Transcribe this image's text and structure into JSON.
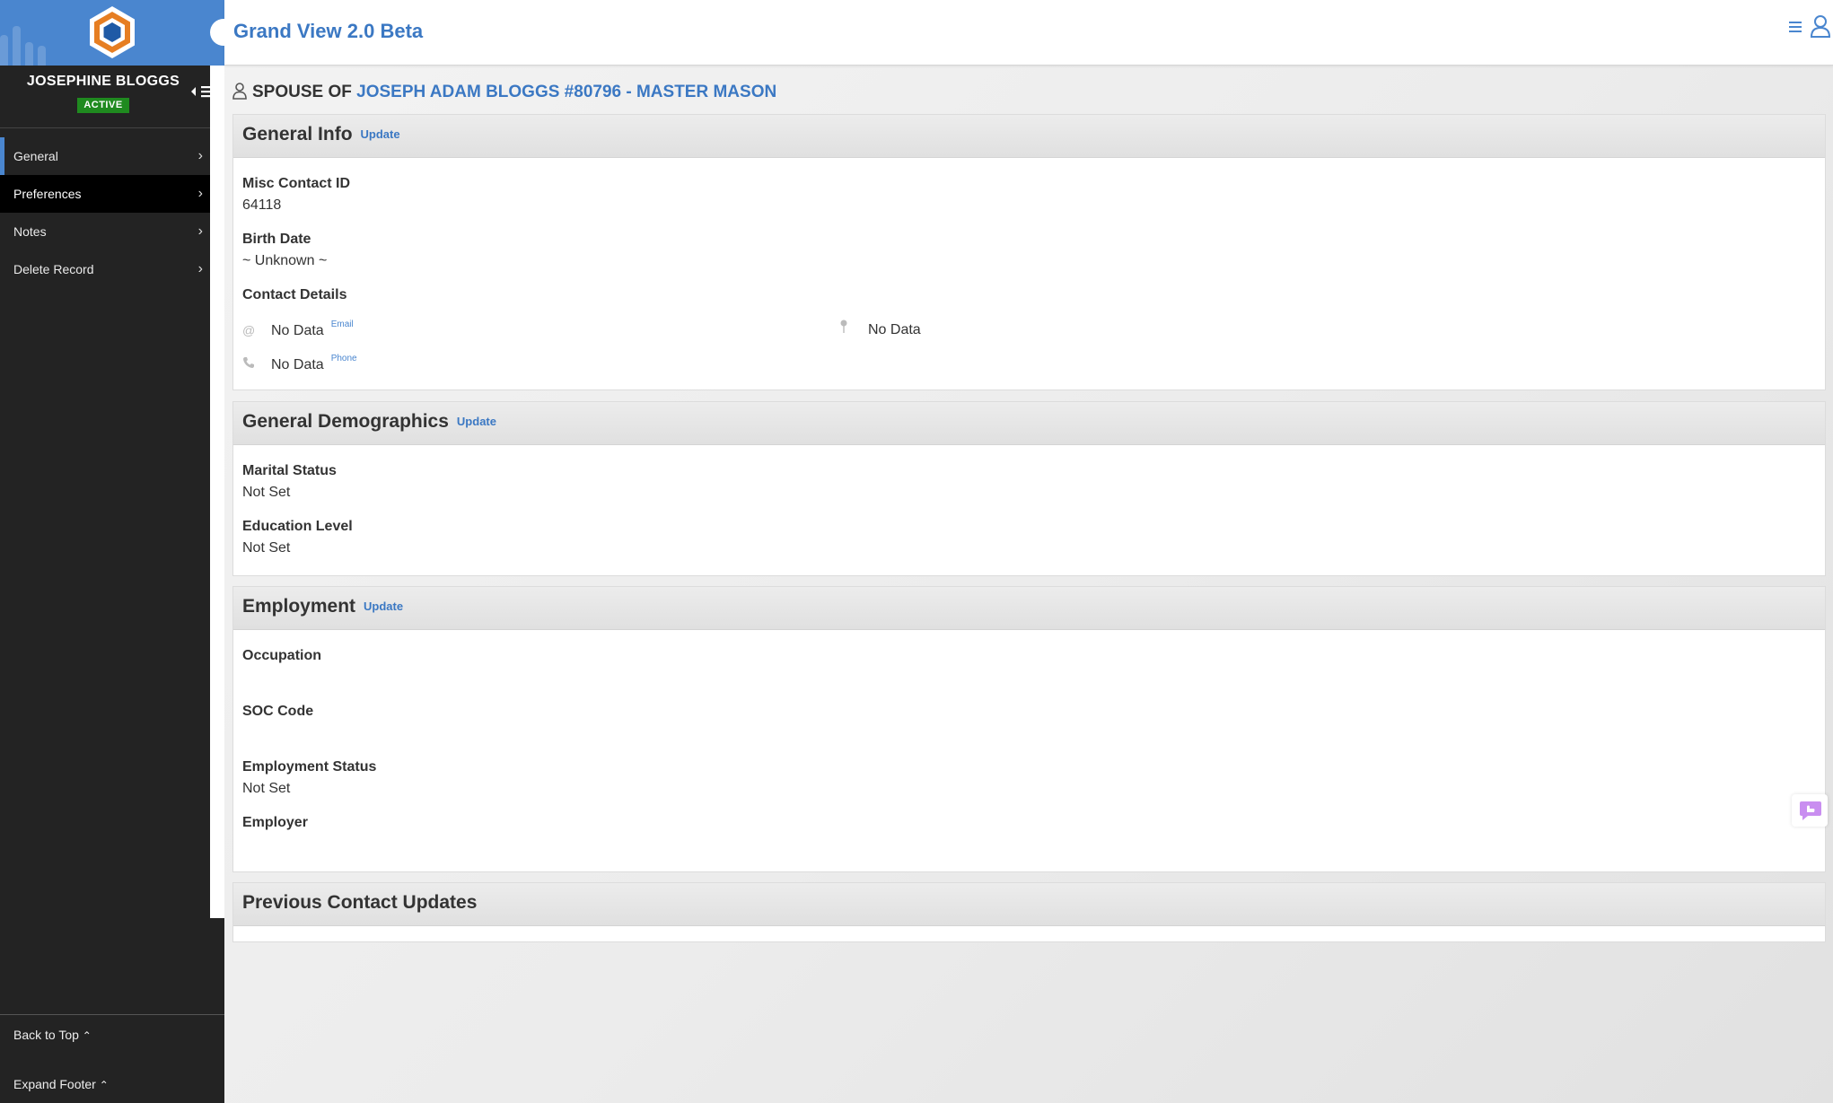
{
  "app": {
    "title": "Grand View 2.0 Beta"
  },
  "sidebar": {
    "user_name": "JOSEPHINE BLOGGS",
    "status": "ACTIVE",
    "items": [
      {
        "label": "General"
      },
      {
        "label": "Preferences"
      },
      {
        "label": "Notes"
      },
      {
        "label": "Delete Record"
      }
    ],
    "back_to_top": "Back to Top",
    "expand_footer": "Expand Footer"
  },
  "page": {
    "prefix": "SPOUSE OF",
    "link": "JOSEPH ADAM BLOGGS #80796 - MASTER MASON"
  },
  "general_info": {
    "title": "General Info",
    "update": "Update",
    "misc_contact_id_label": "Misc Contact ID",
    "misc_contact_id": "64118",
    "birth_date_label": "Birth Date",
    "birth_date": "~ Unknown ~",
    "contact_details_label": "Contact Details",
    "email_value": "No Data",
    "email_tag": "Email",
    "phone_value": "No Data",
    "phone_tag": "Phone",
    "address_value": "No Data"
  },
  "demographics": {
    "title": "General Demographics",
    "update": "Update",
    "marital_label": "Marital Status",
    "marital_value": "Not Set",
    "education_label": "Education Level",
    "education_value": "Not Set"
  },
  "employment": {
    "title": "Employment",
    "update": "Update",
    "occupation_label": "Occupation",
    "occupation_value": "",
    "soc_label": "SOC Code",
    "soc_value": "",
    "status_label": "Employment Status",
    "status_value": "Not Set",
    "employer_label": "Employer",
    "employer_value": ""
  },
  "previous_updates": {
    "title": "Previous Contact Updates"
  },
  "colors": {
    "accent": "#3b78c3",
    "sidebar_bg": "#232323",
    "active_badge": "#1f8a1f"
  }
}
